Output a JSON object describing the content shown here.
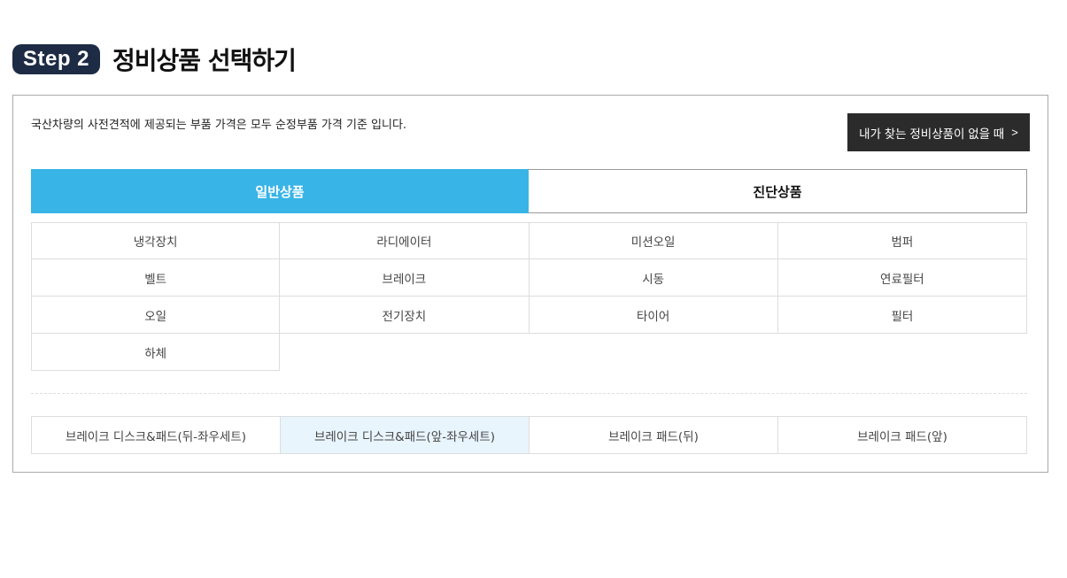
{
  "step": {
    "badge": "Step 2",
    "title": "정비상품 선택하기"
  },
  "notice": "국산차량의 사전견적에 제공되는 부품 가격은 모두 순정부품 가격 기준 입니다.",
  "missing_button": {
    "label": "내가 찾는 정비상품이 없을 때",
    "arrow": ">"
  },
  "tabs": [
    {
      "label": "일반상품",
      "active": true
    },
    {
      "label": "진단상품",
      "active": false
    }
  ],
  "categories": [
    [
      "냉각장치",
      "라디에이터",
      "미션오일",
      "범퍼"
    ],
    [
      "벨트",
      "브레이크",
      "시동",
      "연료필터"
    ],
    [
      "오일",
      "전기장치",
      "타이어",
      "필터"
    ],
    [
      "하체"
    ]
  ],
  "products": [
    {
      "label": "브레이크 디스크&패드(뒤-좌우세트)",
      "selected": false
    },
    {
      "label": "브레이크 디스크&패드(앞-좌우세트)",
      "selected": true
    },
    {
      "label": "브레이크 패드(뒤)",
      "selected": false
    },
    {
      "label": "브레이크 패드(앞)",
      "selected": false
    }
  ],
  "colors": {
    "badge_bg": "#1d2b44",
    "active_tab": "#38b4e6",
    "selected_product_bg": "#e9f5fd",
    "dark_button": "#2b2b2b"
  }
}
